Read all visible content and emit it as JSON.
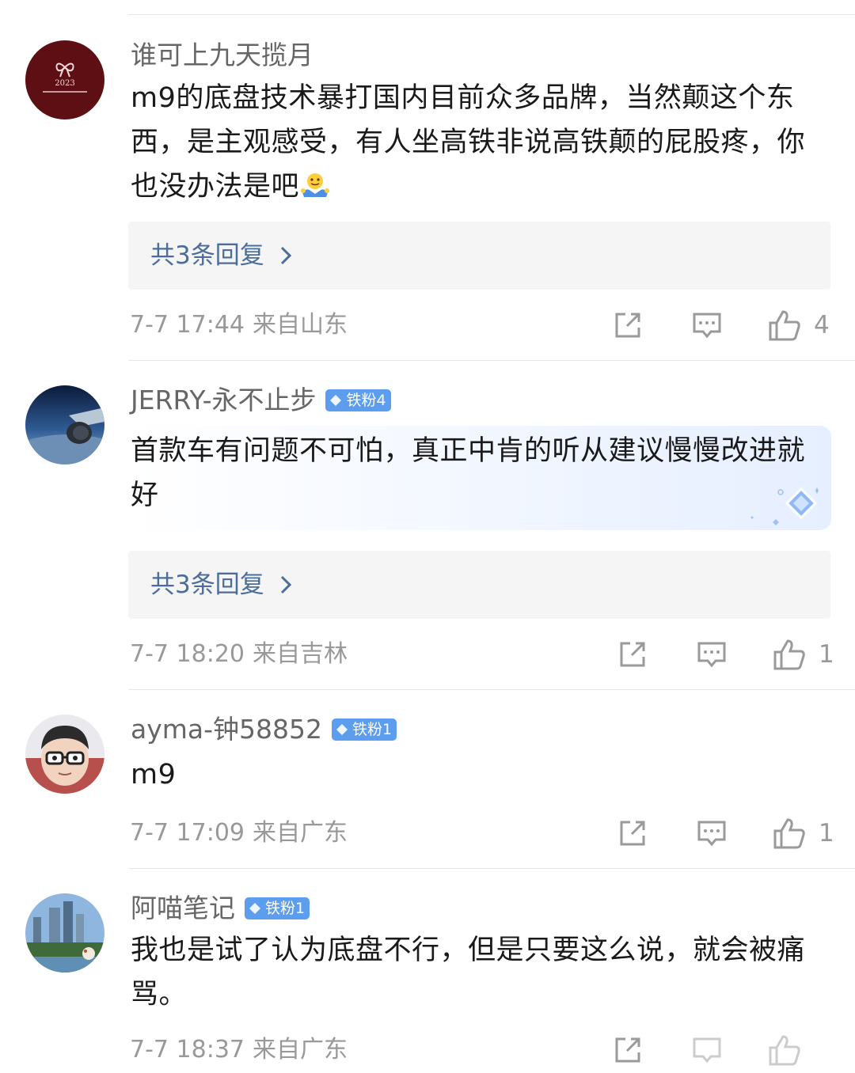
{
  "comments": [
    {
      "author": "谁可上九天揽月",
      "badge": "",
      "avatar_text": "2023",
      "text": "m9的底盘技术暴打国内目前众多品牌，当然颠这个东西，是主观感受，有人坐高铁非说高铁颠的屁股疼，你也没办法是吧",
      "emoji": "shrug-emoji",
      "replies_label": "共3条回复",
      "time": "7-7 17:44",
      "location": "来自山东",
      "likes": "4"
    },
    {
      "author": "JERRY-永不止步",
      "badge": "铁粉4",
      "text": "首款车有问题不可怕，真正中肯的听从建议慢慢改进就好",
      "replies_label": "共3条回复",
      "time": "7-7 18:20",
      "location": "来自吉林",
      "likes": "1"
    },
    {
      "author": "ayma-钟58852",
      "badge": "铁粉1",
      "text": "m9",
      "replies_label": "",
      "time": "7-7 17:09",
      "location": "来自广东",
      "likes": "1"
    },
    {
      "author": "阿喵笔记",
      "badge": "铁粉1",
      "text": "我也是试了认为底盘不行，但是只要这么说，就会被痛骂。",
      "replies_label": "",
      "time": "7-7 18:37",
      "location": "来自广东",
      "likes": ""
    }
  ],
  "colors": {
    "name": "#666666",
    "meta": "#999999",
    "replies_link": "#4a6d9c",
    "badge": "#5c9ded",
    "reply_box": "#f5f5f5"
  },
  "icons": [
    "share-icon",
    "comment-icon",
    "like-icon",
    "chevron-right-icon",
    "diamond-icon"
  ]
}
